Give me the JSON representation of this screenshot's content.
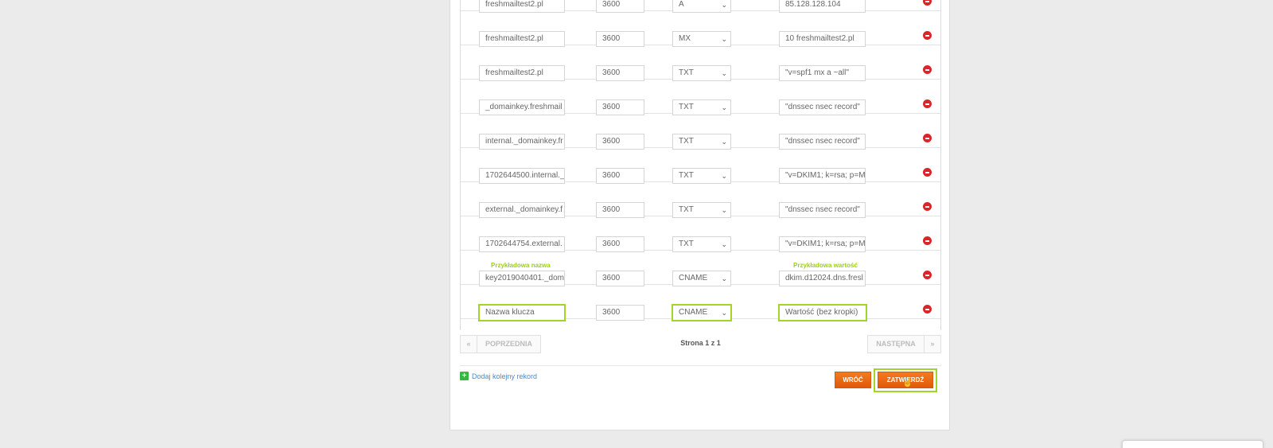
{
  "records": [
    {
      "name": "freshmailtest2.pl",
      "ttl": "3600",
      "type": "A",
      "value": "85.128.128.104"
    },
    {
      "name": "freshmailtest2.pl",
      "ttl": "3600",
      "type": "MX",
      "value": "10 freshmailtest2.pl"
    },
    {
      "name": "freshmailtest2.pl",
      "ttl": "3600",
      "type": "TXT",
      "value": "\"v=spf1 mx a ~all\""
    },
    {
      "name": "_domainkey.freshmail",
      "ttl": "3600",
      "type": "TXT",
      "value": "\"dnssec nsec record\""
    },
    {
      "name": "internal._domainkey.fr",
      "ttl": "3600",
      "type": "TXT",
      "value": "\"dnssec nsec record\""
    },
    {
      "name": "1702644500.internal._",
      "ttl": "3600",
      "type": "TXT",
      "value": "\"v=DKIM1; k=rsa; p=M"
    },
    {
      "name": "external._domainkey.f",
      "ttl": "3600",
      "type": "TXT",
      "value": "\"dnssec nsec record\""
    },
    {
      "name": "1702644754.external.",
      "ttl": "3600",
      "type": "TXT",
      "value": "\"v=DKIM1; k=rsa; p=M"
    },
    {
      "name": "key2019040401._dom",
      "ttl": "3600",
      "type": "CNAME",
      "value": "dkim.d12024.dns.fresl"
    },
    {
      "name": "",
      "name_placeholder": "Nazwa klucza",
      "ttl": "3600",
      "type": "CNAME",
      "value": "",
      "value_placeholder": "Wartość (bez kropki)"
    }
  ],
  "annotations": {
    "example_name": "Przykładowa nazwa",
    "example_value": "Przykładowa wartość"
  },
  "pagination": {
    "first": "«",
    "prev": "POPRZEDNIA",
    "info": "Strona 1 z 1",
    "next": "NASTĘPNA",
    "last": "»"
  },
  "actions": {
    "add_record": "Dodaj kolejny rekord",
    "back": "WRÓĆ",
    "confirm": "ZATWIERDŹ"
  },
  "colors": {
    "highlight": "#a3d42a",
    "accent_orange": "#f47b20",
    "delete_red": "#d8262b",
    "link_blue": "#4a8ad4"
  }
}
